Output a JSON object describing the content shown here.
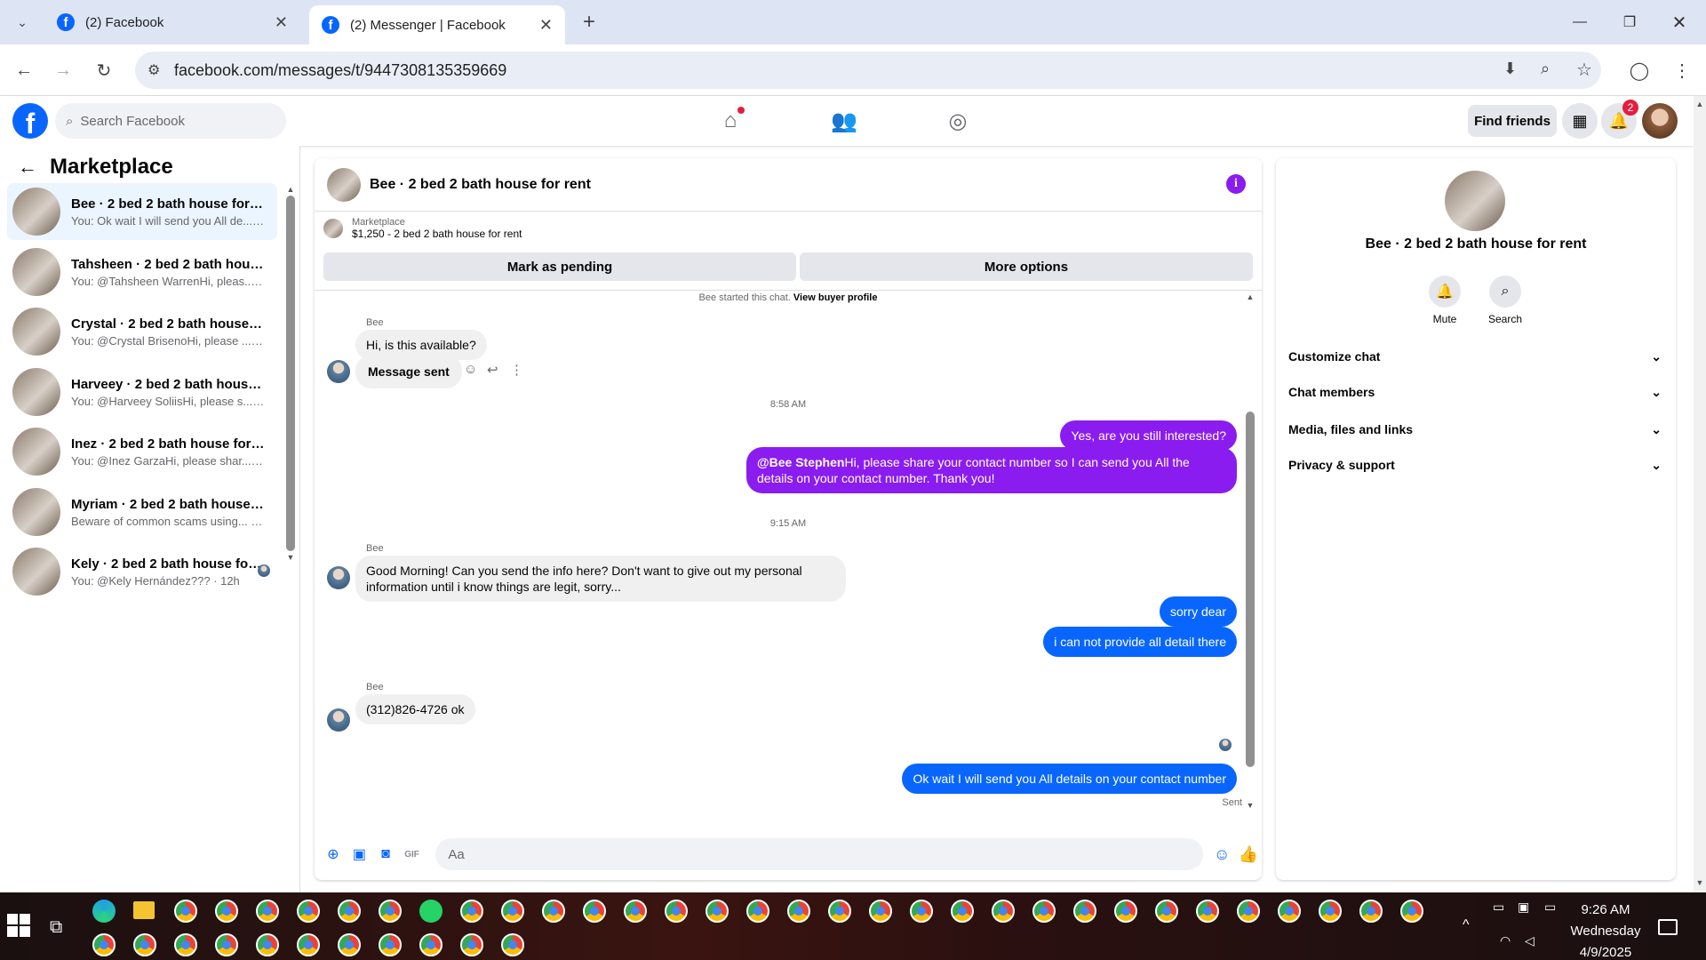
{
  "browser": {
    "tabs": [
      {
        "title": "(2) Facebook"
      },
      {
        "title": "(2) Messenger | Facebook"
      }
    ],
    "url": "facebook.com/messages/t/9447308135359669"
  },
  "fb_header": {
    "search_placeholder": "Search Facebook",
    "find_friends": "Find friends",
    "notification_count": "2"
  },
  "sidebar": {
    "title": "Marketplace",
    "conversations": [
      {
        "title": "Bee · 2 bed 2 bath house for rent",
        "preview": "You: Ok wait I will send you All de... · 1m"
      },
      {
        "title": "Tahsheen · 2 bed 2 bath house f...",
        "preview": "You: @Tahsheen WarrenHi, pleas... · 27m"
      },
      {
        "title": "Crystal · 2 bed 2 bath house for...",
        "preview": "You: @Crystal BrisenoHi, please ... · 27m"
      },
      {
        "title": "Harveey · 2 bed 2 bath house f...",
        "preview": "You: @Harveey SoliisHi, please s... · 27m"
      },
      {
        "title": "Inez · 2 bed 2 bath house for rent",
        "preview": "You: @Inez GarzaHi, please shar... · 27m"
      },
      {
        "title": "Myriam · 2 bed 2 bath house fo...",
        "preview": "Beware of common scams using... · 28m"
      },
      {
        "title": "Kely · 2 bed 2 bath house for ...",
        "preview": "You: @Kely Hernández??? · 12h"
      }
    ]
  },
  "chat": {
    "title": "Bee · 2 bed 2 bath house for rent",
    "listing_category": "Marketplace",
    "listing_price": "$1,250 - 2 bed 2 bath house for rent",
    "mark_pending": "Mark as pending",
    "more_options": "More options",
    "started_text": "Bee started this chat.",
    "view_profile": "View buyer profile",
    "sender_name": "Bee",
    "msg1": "Hi, is this available?",
    "msg2": "Message sent",
    "time1": "8:58 AM",
    "msg3": "Yes, are you still interested?",
    "msg4_mention": "@Bee Stephen",
    "msg4_text": "Hi, please share your contact number so I can send you All the details on your contact number. Thank you!",
    "time2": "9:15 AM",
    "msg5": "Good Morning! Can you send the info here? Don't want to give out my personal information until i know things are legit, sorry...",
    "msg6": "sorry dear",
    "msg7": "i can not provide all detail there",
    "msg8": "(312)826-4726 ok",
    "msg9": "Ok wait I will send you All details on your contact number",
    "status": "Sent",
    "composer_placeholder": "Aa"
  },
  "details_panel": {
    "title": "Bee · 2 bed 2 bath house for rent",
    "mute": "Mute",
    "search": "Search",
    "sections": [
      "Customize chat",
      "Chat members",
      "Media, files and links",
      "Privacy & support"
    ]
  },
  "taskbar": {
    "time": "9:26 AM",
    "day": "Wednesday",
    "date": "4/9/2025"
  },
  "colors": {
    "fb_blue": "#0866ff",
    "sent_purple": "#8a1cf0"
  }
}
